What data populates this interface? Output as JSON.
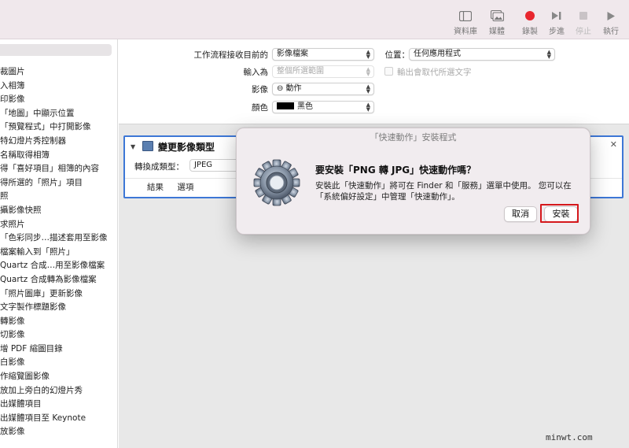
{
  "toolbar": {
    "buttons": [
      {
        "label": "資料庫",
        "icon": "library-icon",
        "enabled": true
      },
      {
        "label": "媒體",
        "icon": "media-icon",
        "enabled": true
      },
      {
        "label": "錄製",
        "icon": "record-icon",
        "enabled": true,
        "color": "#e8262e"
      },
      {
        "label": "步進",
        "icon": "step-icon",
        "enabled": true
      },
      {
        "label": "停止",
        "icon": "stop-icon",
        "enabled": false
      },
      {
        "label": "執行",
        "icon": "run-icon",
        "enabled": true
      }
    ]
  },
  "sidebar": {
    "items": [
      "裁圖片",
      "入相簿",
      "印影像",
      "「地圖」中顯示位置",
      "「預覽程式」中打開影像",
      "特幻燈片秀控制器",
      "名稱取得相簿",
      "得「喜好項目」相簿的內容",
      "得所選的「照片」項目",
      "照",
      "攝影像快照",
      "求照片",
      "「色彩同步…描述套用至影像",
      "檔案輸入到「照片」",
      "Quartz 合成…用至影像檔案",
      "Quartz 合成轉為影像檔案",
      "「照片圖庫」更新影像",
      "文字製作標題影像",
      "轉影像",
      "切影像",
      "增 PDF 縮圖目錄",
      "白影像",
      "作縮覽圖影像",
      "放加上旁白的幻燈片秀",
      "出媒體項目",
      "出媒體項目至 Keynote",
      "放影像"
    ]
  },
  "workflow_options": {
    "receives_label": "工作流程接收目前的",
    "receives_value": "影像檔案",
    "location_label": "位置：",
    "location_value": "任何應用程式",
    "input_label": "輸入為",
    "input_value": "整個所選範圍",
    "output_replaces_label": "輸出會取代所選文字",
    "image_label": "影像",
    "image_value": "⊖ 動作",
    "color_label": "顏色",
    "color_value": "黑色",
    "color_swatch": "#000000"
  },
  "action": {
    "title": "變更影像類型",
    "convert_label": "轉換成類型：",
    "convert_value": "JPEG",
    "tabs": [
      "結果",
      "選項"
    ],
    "border_color": "#3d77d6"
  },
  "dialog": {
    "title": "「快速動作」安裝程式",
    "heading": "要安裝「PNG 轉 JPG」快速動作嗎？",
    "body_line1": "安裝此「快速動作」將可在 Finder 和「服務」選單中使用。 您可以在",
    "body_line2": "「系統偏好設定」中管理「快速動作」。",
    "cancel_label": "取消",
    "install_label": "安裝",
    "highlight_color": "#d5181c"
  },
  "watermark": "minwt.com"
}
